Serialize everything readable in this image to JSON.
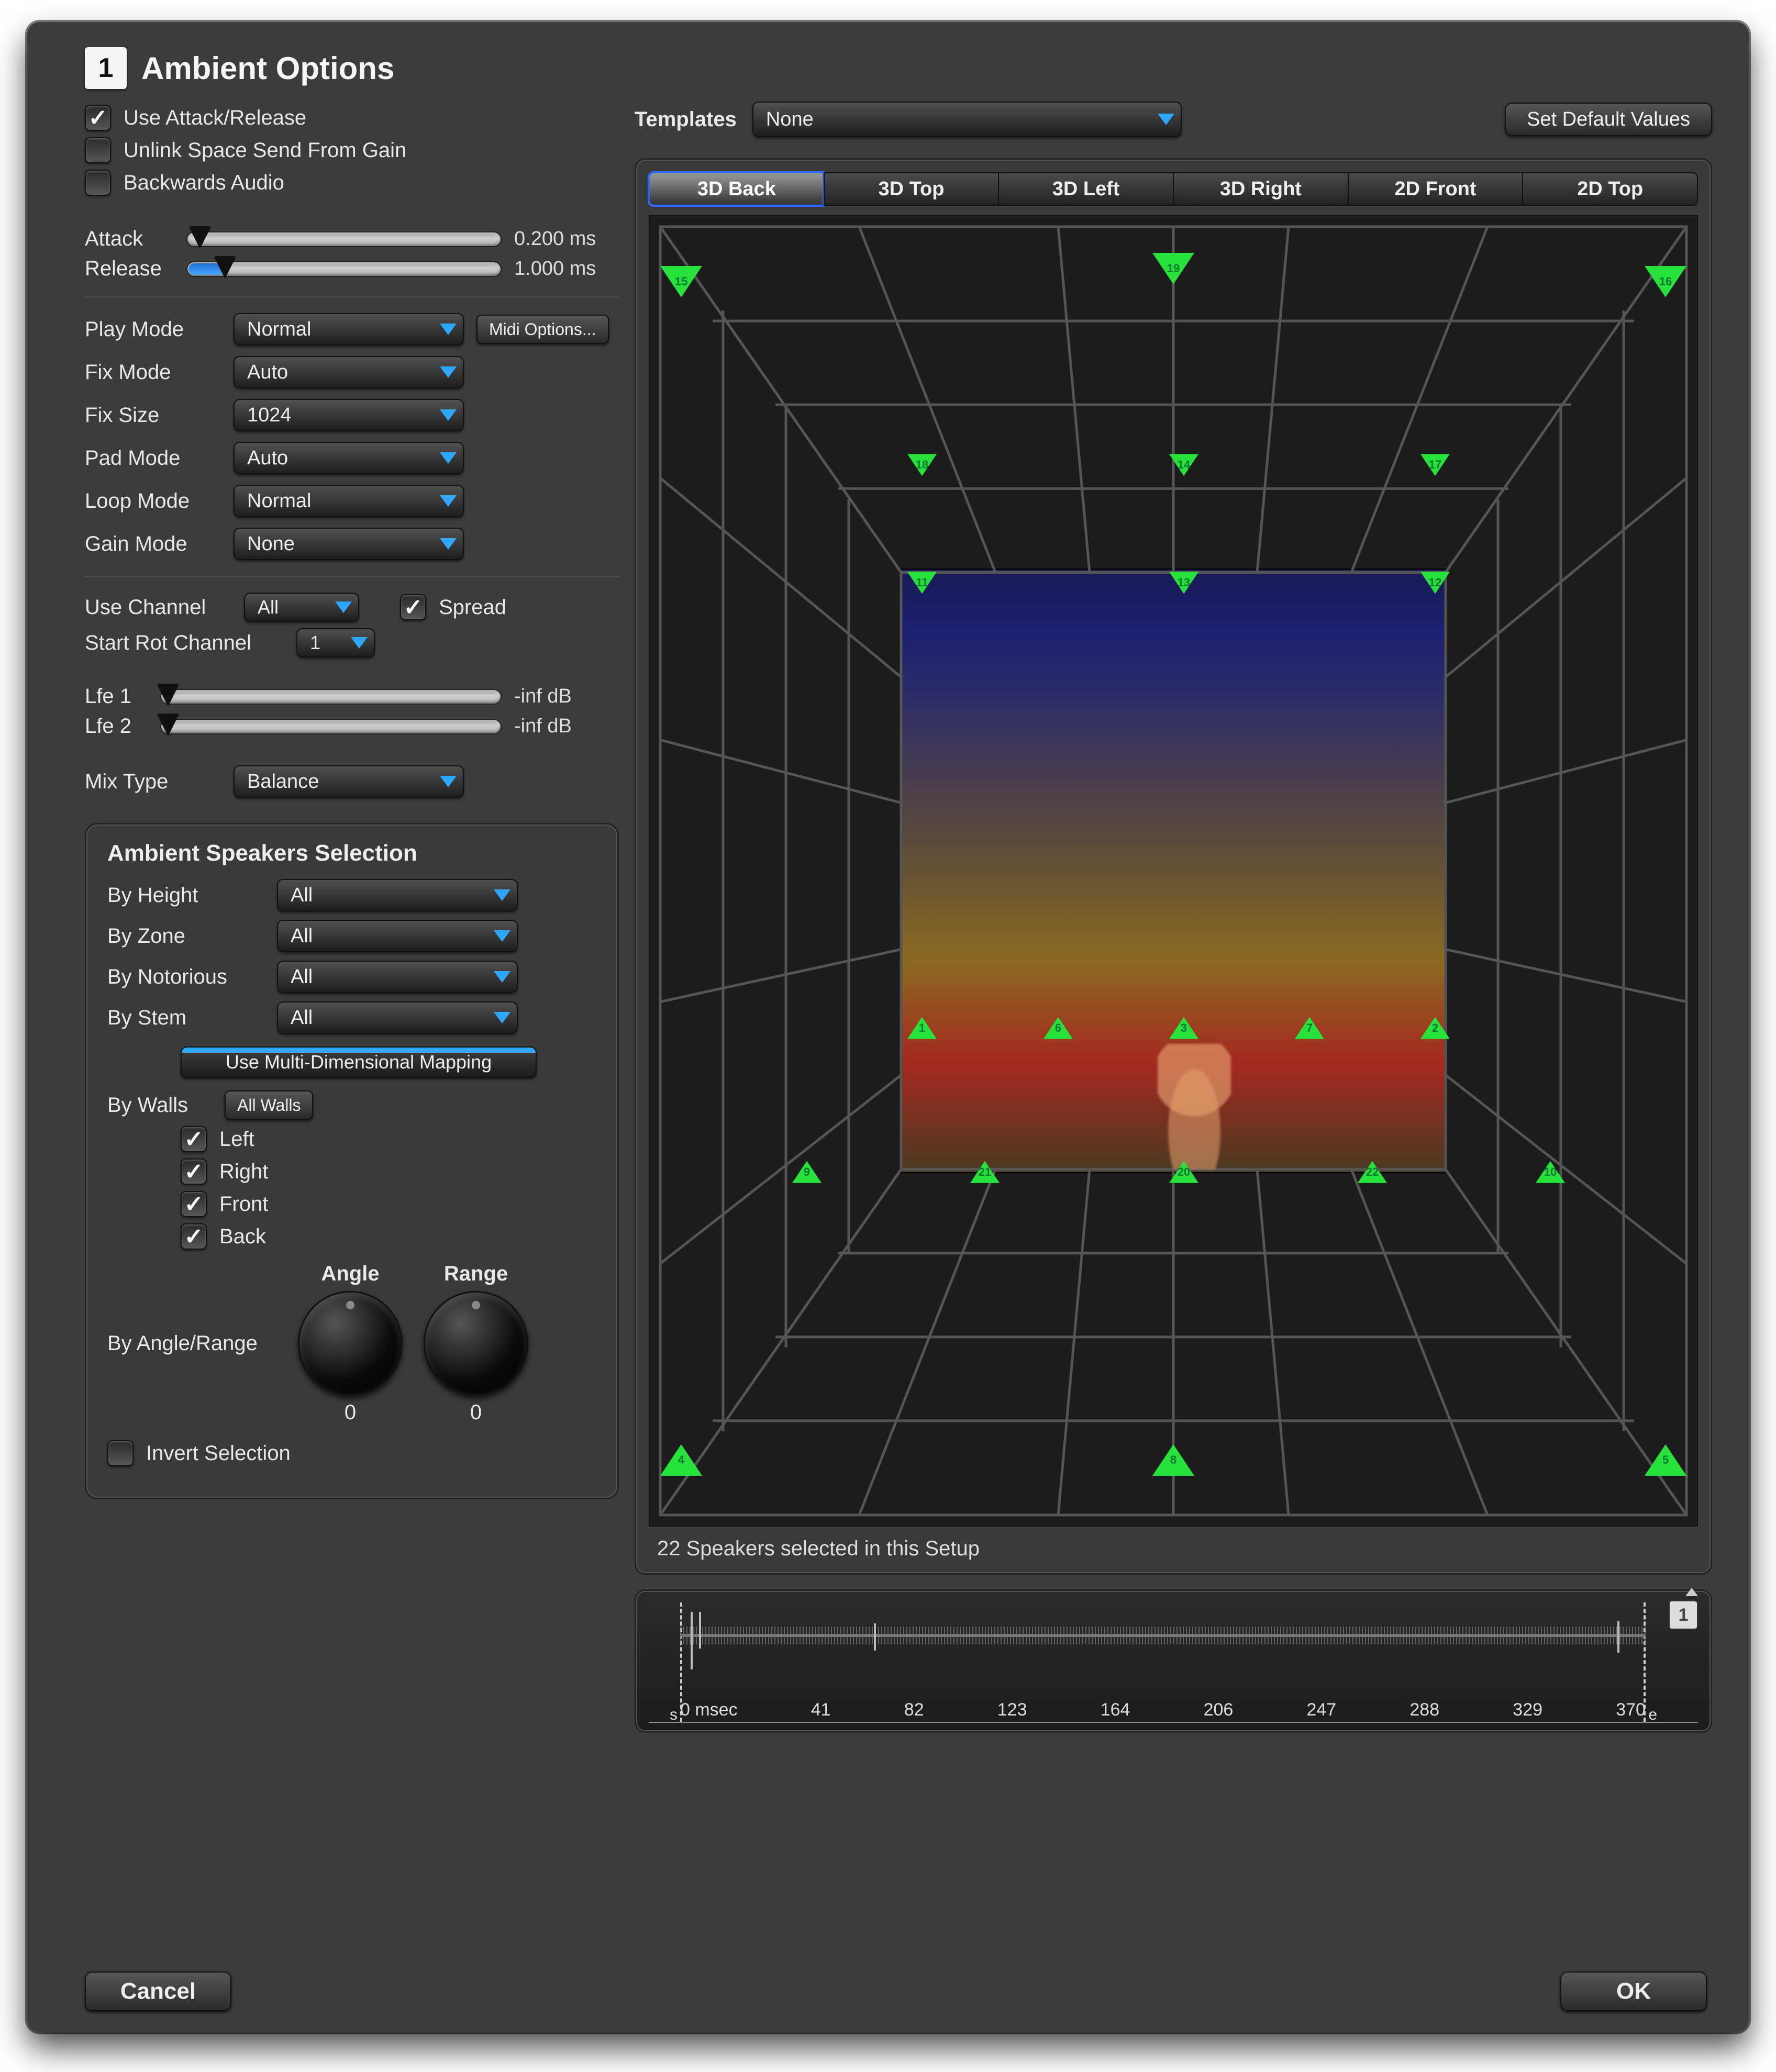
{
  "header": {
    "badge": "1",
    "title": "Ambient Options"
  },
  "checks": {
    "use_attack_release": {
      "label": "Use Attack/Release",
      "checked": true
    },
    "unlink_space": {
      "label": "Unlink Space Send From Gain",
      "checked": false
    },
    "backwards_audio": {
      "label": "Backwards Audio",
      "checked": false
    }
  },
  "attack": {
    "label": "Attack",
    "value_text": "0.200 ms",
    "pos_pct": 4,
    "fill_pct": 0
  },
  "release": {
    "label": "Release",
    "value_text": "1.000 ms",
    "pos_pct": 12,
    "fill_pct": 12
  },
  "modes": {
    "play_mode": {
      "label": "Play Mode",
      "value": "Normal"
    },
    "fix_mode": {
      "label": "Fix Mode",
      "value": "Auto"
    },
    "fix_size": {
      "label": "Fix Size",
      "value": "1024"
    },
    "pad_mode": {
      "label": "Pad Mode",
      "value": "Auto"
    },
    "loop_mode": {
      "label": "Loop Mode",
      "value": "Normal"
    },
    "gain_mode": {
      "label": "Gain Mode",
      "value": "None"
    }
  },
  "midi_button": "Midi Options...",
  "use_channel": {
    "label": "Use Channel",
    "value": "All"
  },
  "spread": {
    "label": "Spread",
    "checked": true
  },
  "start_rot": {
    "label": "Start Rot Channel",
    "value": "1"
  },
  "lfe1": {
    "label": "Lfe 1",
    "value_text": "-inf dB",
    "pos_pct": 2
  },
  "lfe2": {
    "label": "Lfe 2",
    "value_text": "-inf dB",
    "pos_pct": 2
  },
  "mix_type": {
    "label": "Mix Type",
    "value": "Balance"
  },
  "speakersPanel": {
    "title": "Ambient Speakers Selection",
    "by_height": {
      "label": "By Height",
      "value": "All"
    },
    "by_zone": {
      "label": "By Zone",
      "value": "All"
    },
    "by_notorious": {
      "label": "By Notorious",
      "value": "All"
    },
    "by_stem": {
      "label": "By Stem",
      "value": "All"
    },
    "multi_btn": "Use Multi-Dimensional Mapping",
    "by_walls_label": "By Walls",
    "by_walls_btn": "All Walls",
    "walls": {
      "left": {
        "label": "Left",
        "checked": true
      },
      "right": {
        "label": "Right",
        "checked": true
      },
      "front": {
        "label": "Front",
        "checked": true
      },
      "back": {
        "label": "Back",
        "checked": true
      }
    },
    "angle_label": "Angle",
    "range_label": "Range",
    "angle_value": "0",
    "range_value": "0",
    "by_angle_range": "By Angle/Range",
    "invert": {
      "label": "Invert Selection",
      "checked": false
    }
  },
  "templates": {
    "label": "Templates",
    "value": "None"
  },
  "set_defaults": "Set Default Values",
  "view_tabs": [
    "3D Back",
    "3D Top",
    "3D Left",
    "3D Right",
    "2D Front",
    "2D Top"
  ],
  "view_active": 0,
  "scene_caption": "22 Speakers selected in this Setup",
  "wave": {
    "badge": "1",
    "ticks": [
      "0 msec",
      "41",
      "82",
      "123",
      "164",
      "206",
      "247",
      "288",
      "329",
      "370"
    ],
    "start_marker": "s",
    "end_marker": "e"
  },
  "footer": {
    "cancel": "Cancel",
    "ok": "OK"
  },
  "markers": [
    {
      "n": "15",
      "x": 3,
      "y": 5,
      "big": true,
      "down": true
    },
    {
      "n": "19",
      "x": 50,
      "y": 4,
      "big": true,
      "down": true
    },
    {
      "n": "16",
      "x": 97,
      "y": 5,
      "big": true,
      "down": true
    },
    {
      "n": "18",
      "x": 26,
      "y": 19,
      "down": true
    },
    {
      "n": "14",
      "x": 51,
      "y": 19,
      "down": true
    },
    {
      "n": "17",
      "x": 75,
      "y": 19,
      "down": true
    },
    {
      "n": "11",
      "x": 26,
      "y": 28,
      "down": true
    },
    {
      "n": "13",
      "x": 51,
      "y": 28,
      "down": true
    },
    {
      "n": "12",
      "x": 75,
      "y": 28,
      "down": true
    },
    {
      "n": "1",
      "x": 26,
      "y": 62
    },
    {
      "n": "6",
      "x": 39,
      "y": 62
    },
    {
      "n": "3",
      "x": 51,
      "y": 62
    },
    {
      "n": "7",
      "x": 63,
      "y": 62
    },
    {
      "n": "2",
      "x": 75,
      "y": 62
    },
    {
      "n": "9",
      "x": 15,
      "y": 73
    },
    {
      "n": "21",
      "x": 32,
      "y": 73
    },
    {
      "n": "20",
      "x": 51,
      "y": 73
    },
    {
      "n": "22",
      "x": 69,
      "y": 73
    },
    {
      "n": "10",
      "x": 86,
      "y": 73
    },
    {
      "n": "4",
      "x": 3,
      "y": 95,
      "big": true
    },
    {
      "n": "8",
      "x": 50,
      "y": 95,
      "big": true
    },
    {
      "n": "5",
      "x": 97,
      "y": 95,
      "big": true
    }
  ]
}
